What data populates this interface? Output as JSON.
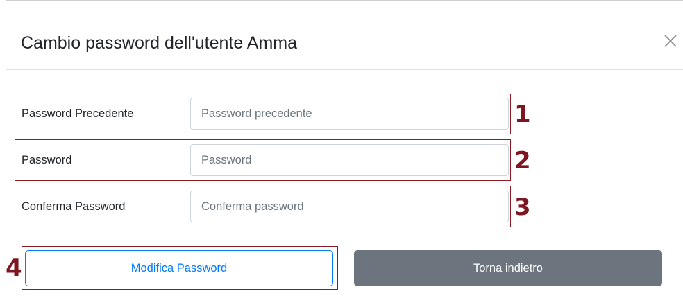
{
  "dialog": {
    "title": "Cambio password dell'utente Amma",
    "close_icon": "close-icon"
  },
  "form": {
    "rows": [
      {
        "label": "Password Precedente",
        "placeholder": "Password precedente",
        "value": "",
        "marker": "1"
      },
      {
        "label": "Password",
        "placeholder": "Password",
        "value": "",
        "marker": "2"
      },
      {
        "label": "Conferma Password",
        "placeholder": "Conferma password",
        "value": "",
        "marker": "3"
      }
    ]
  },
  "footer": {
    "modify_label": "Modifica Password",
    "back_label": "Torna indietro",
    "marker": "4"
  },
  "colors": {
    "annotation_border": "#8b1a24",
    "annotation_number": "#7d1620",
    "primary": "#007bff",
    "secondary": "#6c757d"
  }
}
